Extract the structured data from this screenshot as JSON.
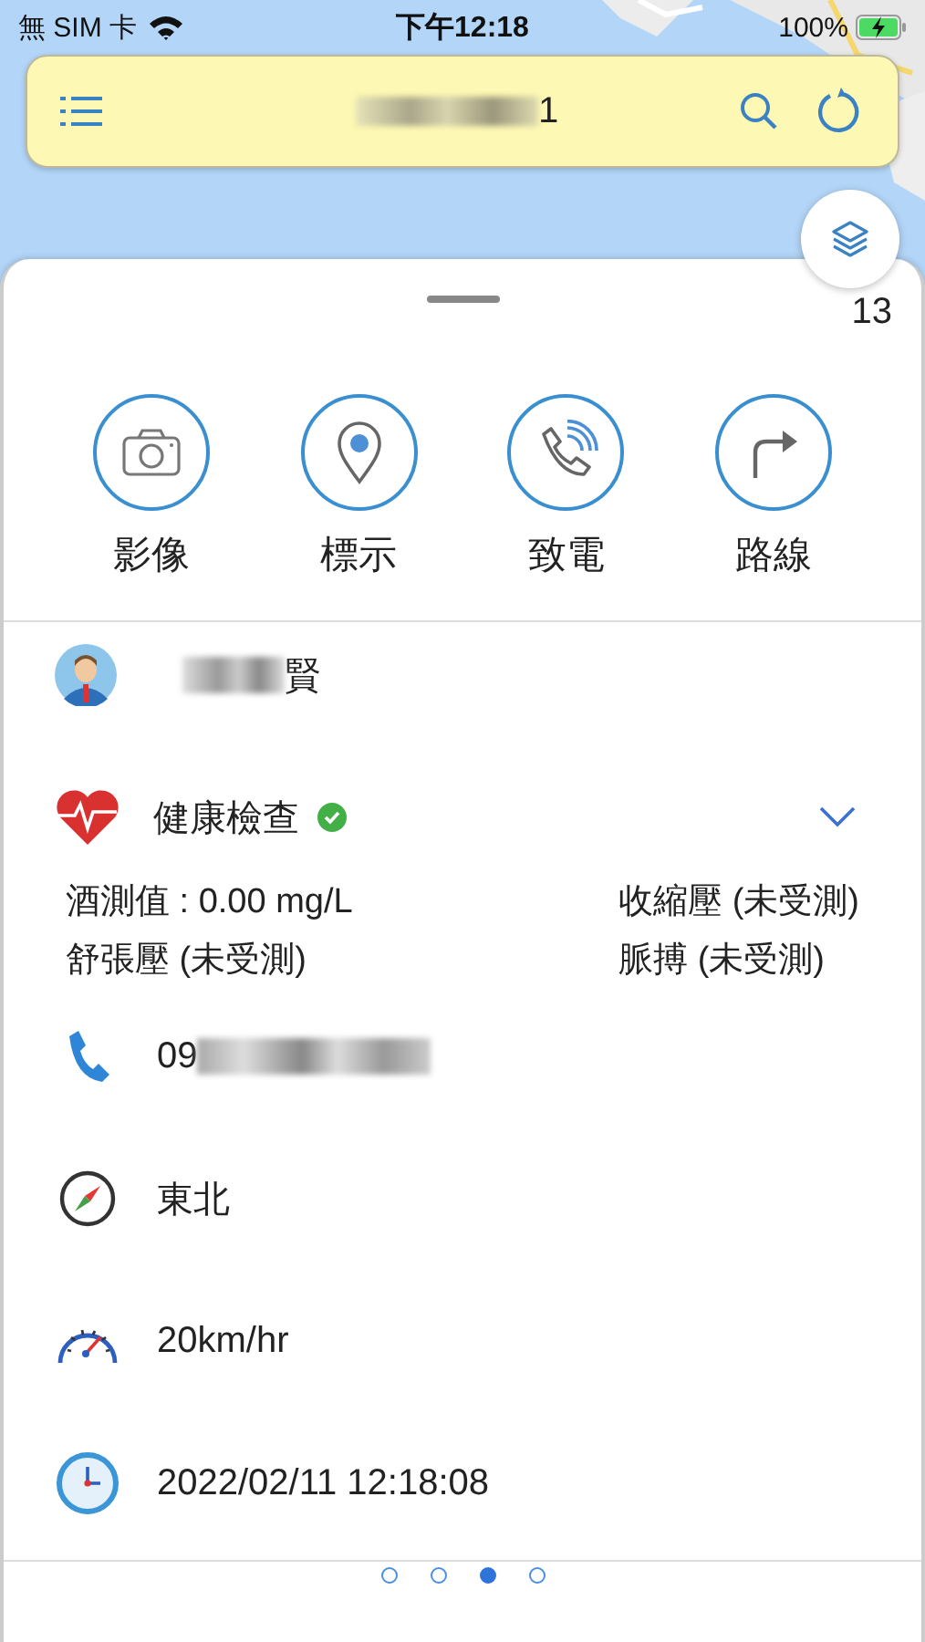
{
  "status_bar": {
    "carrier": "無 SIM 卡",
    "time": "下午12:18",
    "battery": "100%"
  },
  "top_bar": {
    "title": "1"
  },
  "sheet": {
    "count": "13",
    "actions": [
      {
        "kind": "camera",
        "label": "影像"
      },
      {
        "kind": "pin",
        "label": "標示"
      },
      {
        "kind": "call",
        "label": "致電"
      },
      {
        "kind": "route",
        "label": "路線"
      }
    ],
    "person": {
      "name": "賢"
    },
    "health": {
      "title": "健康檢查",
      "verified": true,
      "metrics": [
        "酒測值 : 0.00 mg/L",
        "收縮壓 (未受測)",
        "舒張壓 (未受測)",
        "脈搏 (未受測)"
      ]
    },
    "info_rows": [
      {
        "kind": "phone",
        "text": "09"
      },
      {
        "kind": "heading",
        "text": "東北"
      },
      {
        "kind": "speed",
        "text": "20km/hr"
      },
      {
        "kind": "time",
        "text": "2022/02/11 12:18:08"
      }
    ],
    "page_dots": [
      {
        "selected": false
      },
      {
        "selected": false
      },
      {
        "selected": true
      },
      {
        "selected": false
      }
    ]
  }
}
